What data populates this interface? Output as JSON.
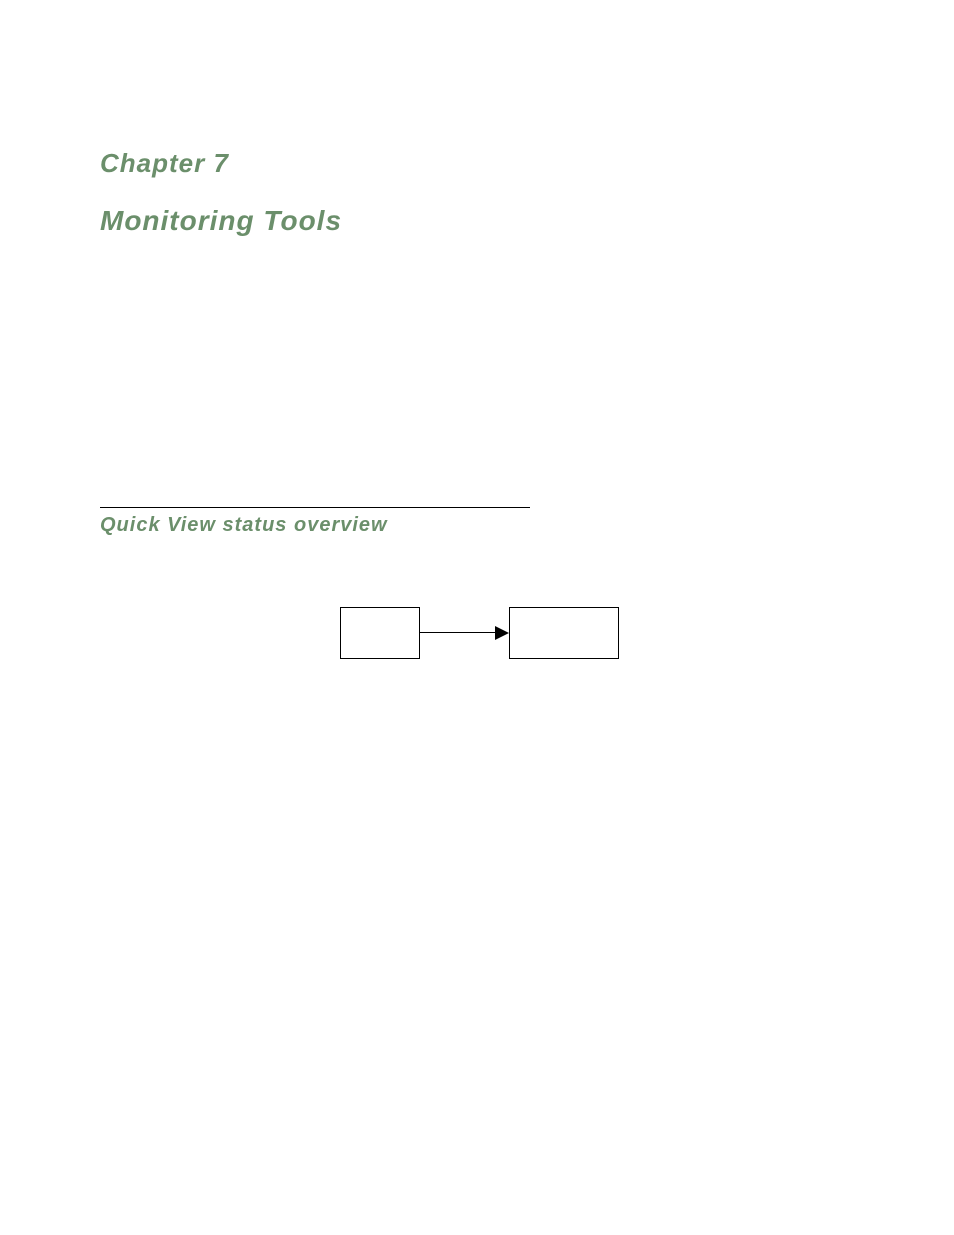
{
  "chapter": {
    "label": "Chapter 7"
  },
  "title": {
    "text": "Monitoring Tools"
  },
  "section": {
    "heading": "Quick View status overview"
  },
  "diagram": {
    "left_box_label": "",
    "right_box_label": ""
  }
}
